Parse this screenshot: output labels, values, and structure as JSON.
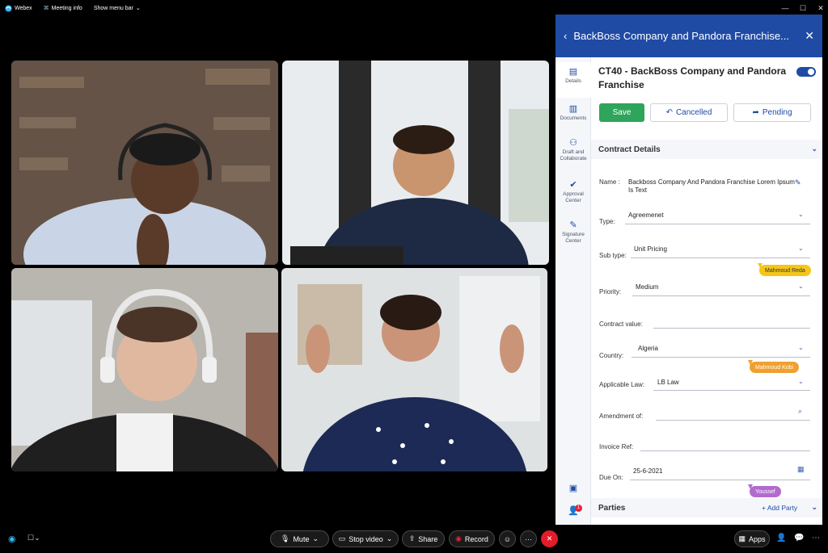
{
  "topbar": {
    "app_name": "Webex",
    "meeting_info": "Meeting info",
    "show_menu": "Show menu bar"
  },
  "panel": {
    "header_title": "BackBoss Company and Pandora Franchise...",
    "rail": [
      {
        "label": "Details",
        "icon": "details-icon"
      },
      {
        "label": "Documents",
        "icon": "documents-icon"
      },
      {
        "label": "Draft and Collaborate",
        "icon": "collaborate-icon"
      },
      {
        "label": "Approval Center",
        "icon": "approval-icon"
      },
      {
        "label": "Signature Center",
        "icon": "signature-icon"
      }
    ],
    "doc_title": "CT40 - BackBoss Company and Pandora Franchise",
    "buttons": {
      "save": "Save",
      "cancelled": "Cancelled",
      "pending": "Pending"
    },
    "section_contract": "Contract Details",
    "fields": {
      "name_label": "Name :",
      "name_value": "Backboss Company And Pandora Franchise Lorem Ipsum Is Text",
      "type_label": "Type:",
      "type_value": "Agreemenet",
      "subtype_label": "Sub type:",
      "subtype_value": "Unit Pricing",
      "priority_label": "Priority:",
      "priority_value": "Medium",
      "contract_value_label": "Contract value:",
      "country_label": "Country:",
      "country_value": "Algeria",
      "law_label": "Applicable Law:",
      "law_value": "LB Law",
      "amendment_label": "Amendment of:",
      "invoice_label": "Invoice Ref:",
      "due_label": "Due On:",
      "due_value": "25-6-2021"
    },
    "tags": {
      "tag1": "Mahmoud Reda",
      "tag2": "Mahmoud Kobi",
      "tag3": "Youssef"
    },
    "section_parties": "Parties",
    "add_party": "+ Add Party",
    "notification_count": "1",
    "colors": {
      "brand": "#1f4ba5",
      "save": "#2ea55b",
      "tag_yellow": "#f5c518",
      "tag_orange": "#f0a030",
      "tag_purple": "#b36ad0"
    }
  },
  "controls": {
    "mute": "Mute",
    "stop_video": "Stop video",
    "share": "Share",
    "record": "Record",
    "apps": "Apps"
  }
}
